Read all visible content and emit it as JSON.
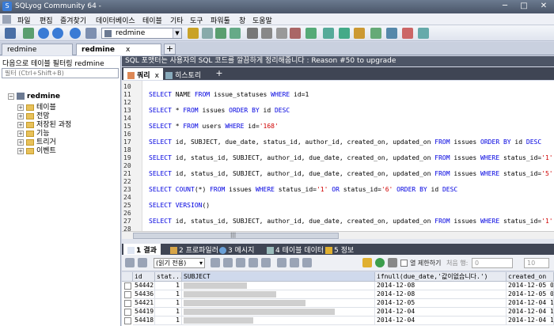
{
  "window": {
    "title": "SQLyog Community 64 -",
    "min": "─",
    "max": "□",
    "close": "✕"
  },
  "menu": [
    "파일",
    "편집",
    "즐겨찾기",
    "데이터베이스",
    "테이블",
    "기타",
    "도구",
    "파워툴",
    "창",
    "도움말"
  ],
  "toolbar": {
    "db_selected": "redmine"
  },
  "connection_tabs": [
    {
      "label": "redmine"
    },
    {
      "label": "redmine",
      "active": true,
      "close": "x"
    }
  ],
  "add_tab": "+",
  "left": {
    "filter_label": "다음으로 테이블 필터링 redmine",
    "filter_placeholder": "필터 (Ctrl+Shift+B)",
    "db_name": "redmine",
    "nodes": [
      "테이블",
      "전망",
      "저장된 과정",
      "기능",
      "트리거",
      "이벤트"
    ]
  },
  "hint": "SQL 포맷터는 사용자의 SQL 코드를 깔끔하게 정리해줍니다 : Reason #50 to upgrade",
  "query_tabs": [
    {
      "label": "쿼리",
      "active": true,
      "close": "x"
    },
    {
      "label": "히스토리"
    }
  ],
  "editor": {
    "line_numbers": [
      "10",
      "11",
      "12",
      "13",
      "14",
      "15",
      "16",
      "17",
      "18",
      "19",
      "20",
      "21",
      "22",
      "23",
      "24",
      "25",
      "26",
      "27",
      "28"
    ],
    "lines": [
      {
        "ln": 11,
        "html": "SELECT NAME FROM issue_statuses WHERE id=1"
      },
      {
        "ln": 13,
        "html": "SELECT * FROM issues ORDER BY id DESC"
      },
      {
        "ln": 15,
        "html": "SELECT * FROM users WHERE id='168'"
      },
      {
        "ln": 17,
        "html": "SELECT id, SUBJECT, due_date, status_id, author_id, created_on, updated_on FROM issues ORDER BY id DESC"
      },
      {
        "ln": 19,
        "html": "SELECT id, status_id, SUBJECT, author_id, due_date, created_on, updated_on FROM issues WHERE status_id='1' OR s"
      },
      {
        "ln": 21,
        "html": "SELECT id, status_id, SUBJECT, author_id, due_date, created_on, updated_on FROM issues WHERE status_id='5' ORDE"
      },
      {
        "ln": 23,
        "html": "SELECT COUNT(*) FROM issues WHERE status_id='1' OR status_id='6' ORDER BY id DESC"
      },
      {
        "ln": 25,
        "html": "SELECT VERSION()"
      },
      {
        "ln": 27,
        "html": "SELECT id, status_id, SUBJECT, author_id, due_date, created_on, updated_on FROM issues WHERE status_id='1' OR s"
      }
    ],
    "scroll_mark": "|||"
  },
  "result_tabs": [
    {
      "label": "1 결과",
      "active": true
    },
    {
      "label": "2 프로파일러"
    },
    {
      "label": "3 메시지"
    },
    {
      "label": "4 테이블 데이터"
    },
    {
      "label": "5 정보"
    }
  ],
  "result_toolbar": {
    "readonly": "(읽기 전용)",
    "limit_label": "열 제한하기",
    "first_row_label": "처음 행:",
    "first_row_value": "0",
    "rows_value": "10"
  },
  "grid": {
    "columns": [
      "id",
      "stat...",
      "SUBJECT",
      "ifnull(due_date,'값이없습니다.')",
      "created_on"
    ],
    "rows": [
      {
        "id": "54442",
        "stat": "1",
        "due": "2014-12-08",
        "created": "2014-12-05 09"
      },
      {
        "id": "54436",
        "stat": "1",
        "due": "2014-12-08",
        "created": "2014-12-05 07"
      },
      {
        "id": "54421",
        "stat": "1",
        "due": "2014-12-05",
        "created": "2014-12-04 17"
      },
      {
        "id": "54419",
        "stat": "1",
        "due": "2014-12-04",
        "created": "2014-12-04 16"
      },
      {
        "id": "54418",
        "stat": "1",
        "due": "2014-12-04",
        "created": "2014-12-04 16"
      }
    ]
  },
  "colors": {
    "accent": "#3f4554",
    "keyword": "#0000e0",
    "string": "#d00000"
  }
}
